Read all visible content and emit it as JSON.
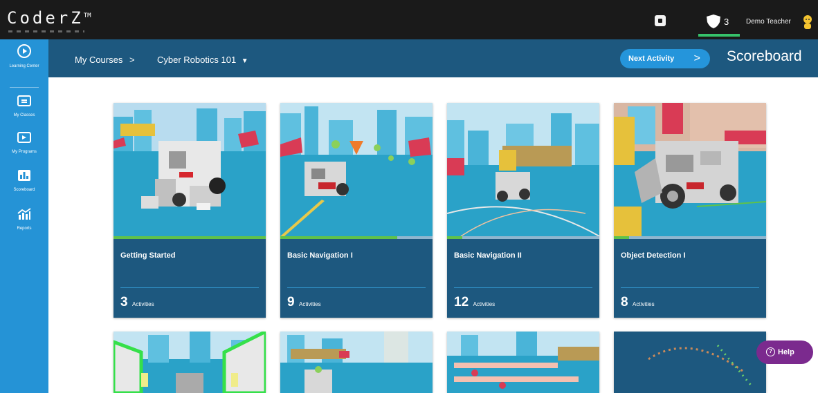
{
  "app": {
    "logo": "CoderZ",
    "logo_mark": "TM",
    "shield_count": "3",
    "user_name": "Demo Teacher"
  },
  "sidebar": {
    "items": [
      {
        "label": "Learning Center",
        "icon": "play-circle-icon"
      },
      {
        "label": "My Classes",
        "icon": "classes-folder-icon"
      },
      {
        "label": "My Programs",
        "icon": "programs-folder-icon"
      },
      {
        "label": "Scoreboard",
        "icon": "scoreboard-icon"
      },
      {
        "label": "Reports",
        "icon": "reports-chart-icon"
      }
    ]
  },
  "header": {
    "crumb_root": "My Courses",
    "crumb_sep": ">",
    "course": "Cyber Robotics 101",
    "next_label": "Next Activity",
    "scoreboard": "Scoreboard"
  },
  "cards": [
    {
      "title": "Getting Started",
      "count": "3",
      "unit": "Activities",
      "progress": 1.0
    },
    {
      "title": "Basic Navigation I",
      "count": "9",
      "unit": "Activities",
      "progress": 0.77
    },
    {
      "title": "Basic Navigation II",
      "count": "12",
      "unit": "Activities",
      "progress": 0.1
    },
    {
      "title": "Object Detection I",
      "count": "8",
      "unit": "Activities",
      "progress": 0.1
    }
  ],
  "help": {
    "label": "Help"
  },
  "colors": {
    "topbar": "#1a1a1a",
    "sidebar": "#2593d6",
    "header": "#1d587f",
    "card": "#1d587f",
    "accent_button": "#2595db",
    "help": "#7b2a8e",
    "progress": "#5fc24a"
  }
}
